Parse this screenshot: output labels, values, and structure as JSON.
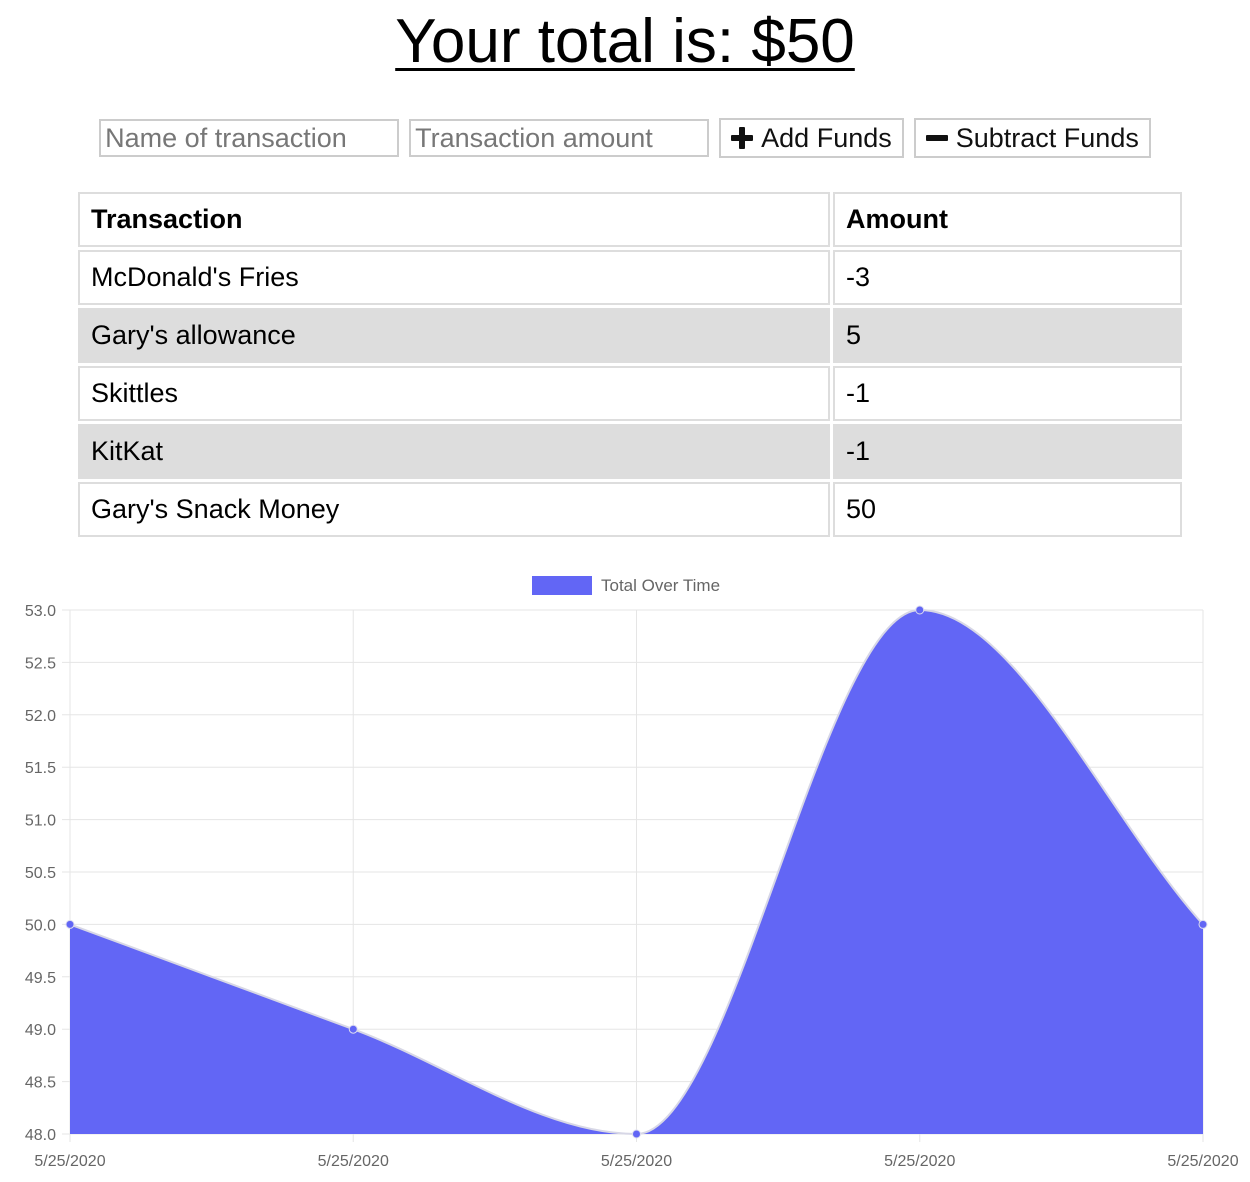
{
  "header": {
    "title": "Your total is: $50"
  },
  "form": {
    "name_placeholder": "Name of transaction",
    "amount_placeholder": "Transaction amount",
    "add_label": "Add Funds",
    "subtract_label": "Subtract Funds"
  },
  "table": {
    "headers": [
      "Transaction",
      "Amount"
    ],
    "rows": [
      {
        "name": "McDonald's Fries",
        "amount": "-3"
      },
      {
        "name": "Gary's allowance",
        "amount": "5"
      },
      {
        "name": "Skittles",
        "amount": "-1"
      },
      {
        "name": "KitKat",
        "amount": "-1"
      },
      {
        "name": "Gary's Snack Money",
        "amount": "50"
      }
    ]
  },
  "chart_data": {
    "type": "area",
    "legend": "top",
    "grid": true,
    "x": [
      "5/25/2020",
      "5/25/2020",
      "5/25/2020",
      "5/25/2020",
      "5/25/2020"
    ],
    "series": [
      {
        "name": "Total Over Time",
        "values": [
          50,
          49,
          48,
          53,
          50
        ],
        "color": "#6266f5"
      }
    ],
    "ylim": [
      48,
      53
    ],
    "yticks": [
      "53.0",
      "52.5",
      "52.0",
      "51.5",
      "51.0",
      "50.5",
      "50.0",
      "49.5",
      "49.0",
      "48.5",
      "48.0"
    ]
  }
}
